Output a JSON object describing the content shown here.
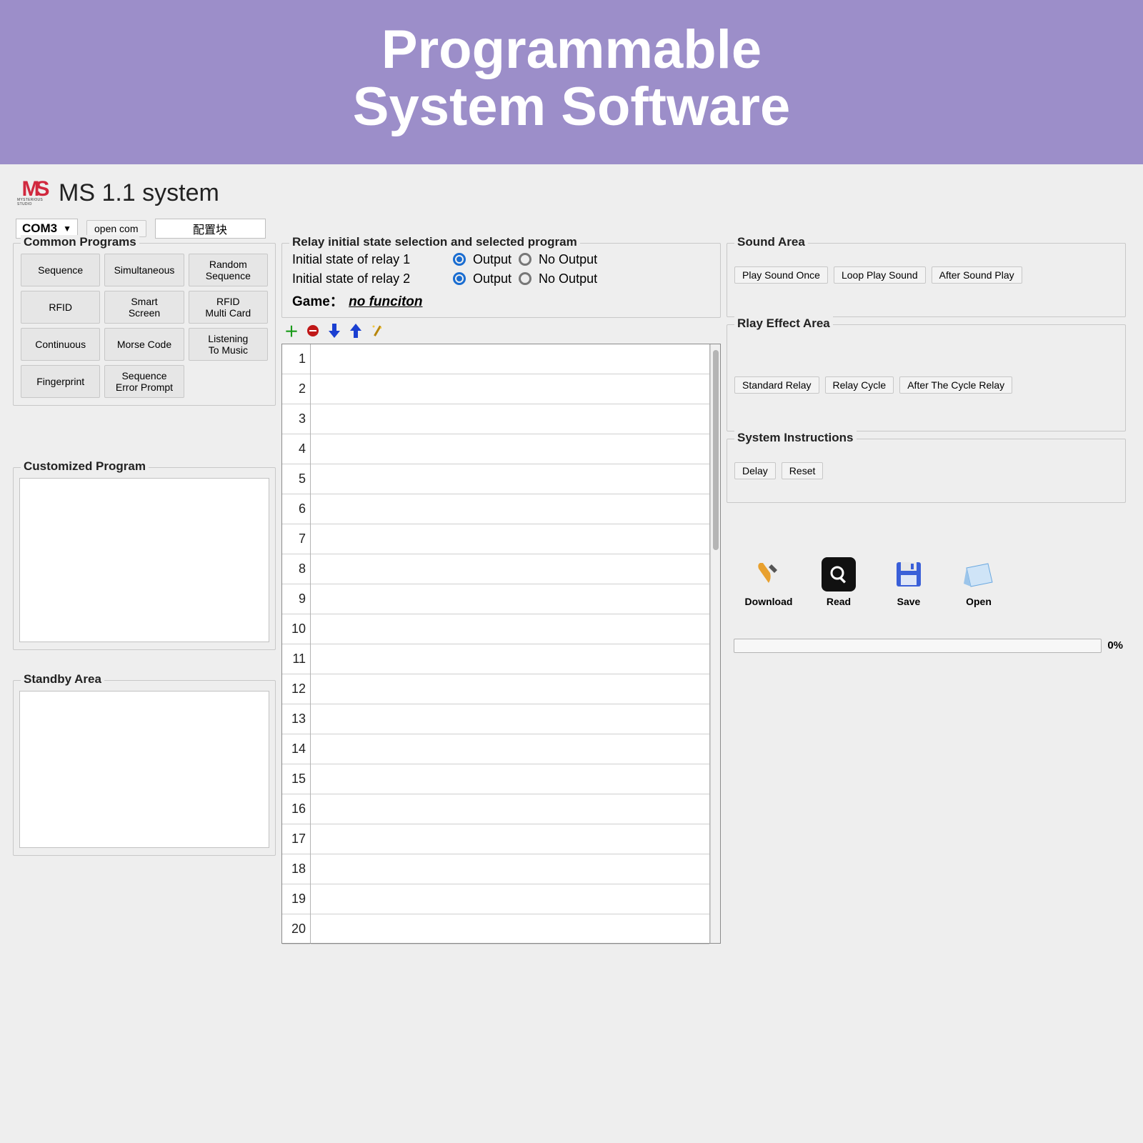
{
  "banner": {
    "line1": "Programmable",
    "line2": "System Software"
  },
  "header": {
    "logo_sub": "MYSTERIOUS STUDIO",
    "title": "MS 1.1 system"
  },
  "toolbar": {
    "com_port": "COM3",
    "open_com": "open com",
    "config_block": "配置块"
  },
  "common_programs": {
    "legend": "Common Programs",
    "items": [
      "Sequence",
      "Simultaneous",
      "Random\nSequence",
      "RFID",
      "Smart\nScreen",
      "RFID\nMulti Card",
      "Continuous",
      "Morse Code",
      "Listening\nTo Music",
      "Fingerprint",
      "Sequence\nError Prompt"
    ]
  },
  "customized": {
    "legend": "Customized Program"
  },
  "standby": {
    "legend": "Standby Area"
  },
  "relay": {
    "legend": "Relay initial state selection and selected program",
    "row1_label": "Initial state of relay 1",
    "row2_label": "Initial state of relay 2",
    "opt_output": "Output",
    "opt_no_output": "No Output",
    "relay1_selected": "Output",
    "relay2_selected": "Output",
    "game_label": "Game：",
    "game_value": "no funciton"
  },
  "iconbar": {
    "add": "add-row",
    "remove": "remove-row",
    "move_down": "move-down",
    "move_up": "move-up",
    "wand": "wand"
  },
  "grid": {
    "rows": 20
  },
  "sound": {
    "legend": "Sound Area",
    "buttons": [
      "Play Sound Once",
      "Loop Play Sound",
      "After Sound Play"
    ]
  },
  "relay_effect": {
    "legend": "Rlay Effect Area",
    "buttons": [
      "Standard Relay",
      "Relay Cycle",
      "After The Cycle Relay"
    ]
  },
  "system_instr": {
    "legend": "System Instructions",
    "buttons": [
      "Delay",
      "Reset"
    ]
  },
  "file_actions": {
    "download": "Download",
    "read": "Read",
    "save": "Save",
    "open": "Open"
  },
  "progress": {
    "value": "0%"
  }
}
